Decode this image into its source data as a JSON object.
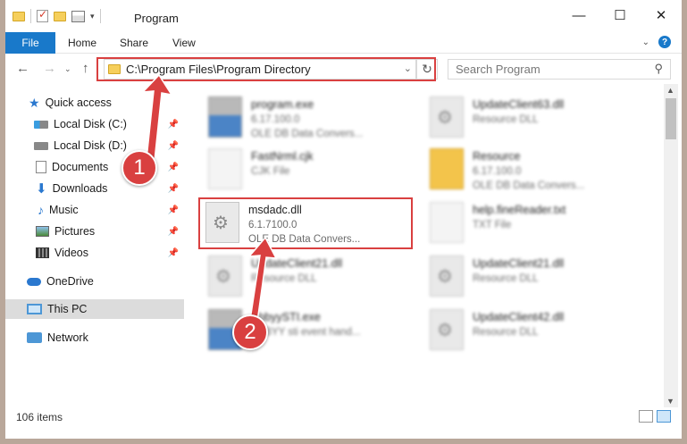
{
  "window": {
    "title": "Program",
    "controls": {
      "minimize": "—",
      "maximize": "☐",
      "close": "✕"
    }
  },
  "ribbon": {
    "file_tab": "File",
    "tabs": [
      "Home",
      "Share",
      "View"
    ]
  },
  "navigation": {
    "back_icon": "arrow-left",
    "forward_icon": "arrow-right",
    "recent_icon": "chevron-down",
    "up_icon": "arrow-up",
    "address": "C:\\Program Files\\Program Directory",
    "search_placeholder": "Search Program"
  },
  "sidebar": {
    "items": [
      {
        "label": "Quick access"
      },
      {
        "label": "Local Disk (C:)"
      },
      {
        "label": "Local Disk (D:)"
      },
      {
        "label": "Documents"
      },
      {
        "label": "Downloads"
      },
      {
        "label": "Music"
      },
      {
        "label": "Pictures"
      },
      {
        "label": "Videos"
      },
      {
        "label": "OneDrive"
      },
      {
        "label": "This PC"
      },
      {
        "label": "Network"
      }
    ]
  },
  "files": [
    {
      "name": "program.exe",
      "line1": "6.17.100.0",
      "line2": "OLE DB Data Convers...",
      "icon": "exe-icon"
    },
    {
      "name": "UpdateClient63.dll",
      "line1": "Resource DLL",
      "line2": "",
      "icon": "dll-icon"
    },
    {
      "name": "FastNrml.cjk",
      "line1": "CJK File",
      "line2": "",
      "icon": "text-file-icon"
    },
    {
      "name": "Resource",
      "line1": "6.17.100.0",
      "line2": "OLE DB Data Convers...",
      "icon": "folder-icon"
    },
    {
      "name": "msdadc.dll",
      "line1": "6.1.7100.0",
      "line2": "OLE DB Data Convers...",
      "icon": "dll-icon"
    },
    {
      "name": "help.fineReader.txt",
      "line1": "TXT File",
      "line2": "",
      "icon": "text-file-icon"
    },
    {
      "name": "UpdateClient21.dll",
      "line1": "Resource DLL",
      "line2": "",
      "icon": "dll-icon"
    },
    {
      "name": "UpdateClient21.dll",
      "line1": "Resource DLL",
      "line2": "",
      "icon": "dll-icon"
    },
    {
      "name": "AbbyySTI.exe",
      "line1": "ABBYY sti event hand...",
      "line2": "",
      "icon": "exe-icon"
    },
    {
      "name": "UpdateClient42.dll",
      "line1": "Resource DLL",
      "line2": "",
      "icon": "dll-icon"
    }
  ],
  "status": {
    "items": "106 items"
  },
  "annotations": {
    "step1": "1",
    "step2": "2",
    "color": "#d94040"
  }
}
